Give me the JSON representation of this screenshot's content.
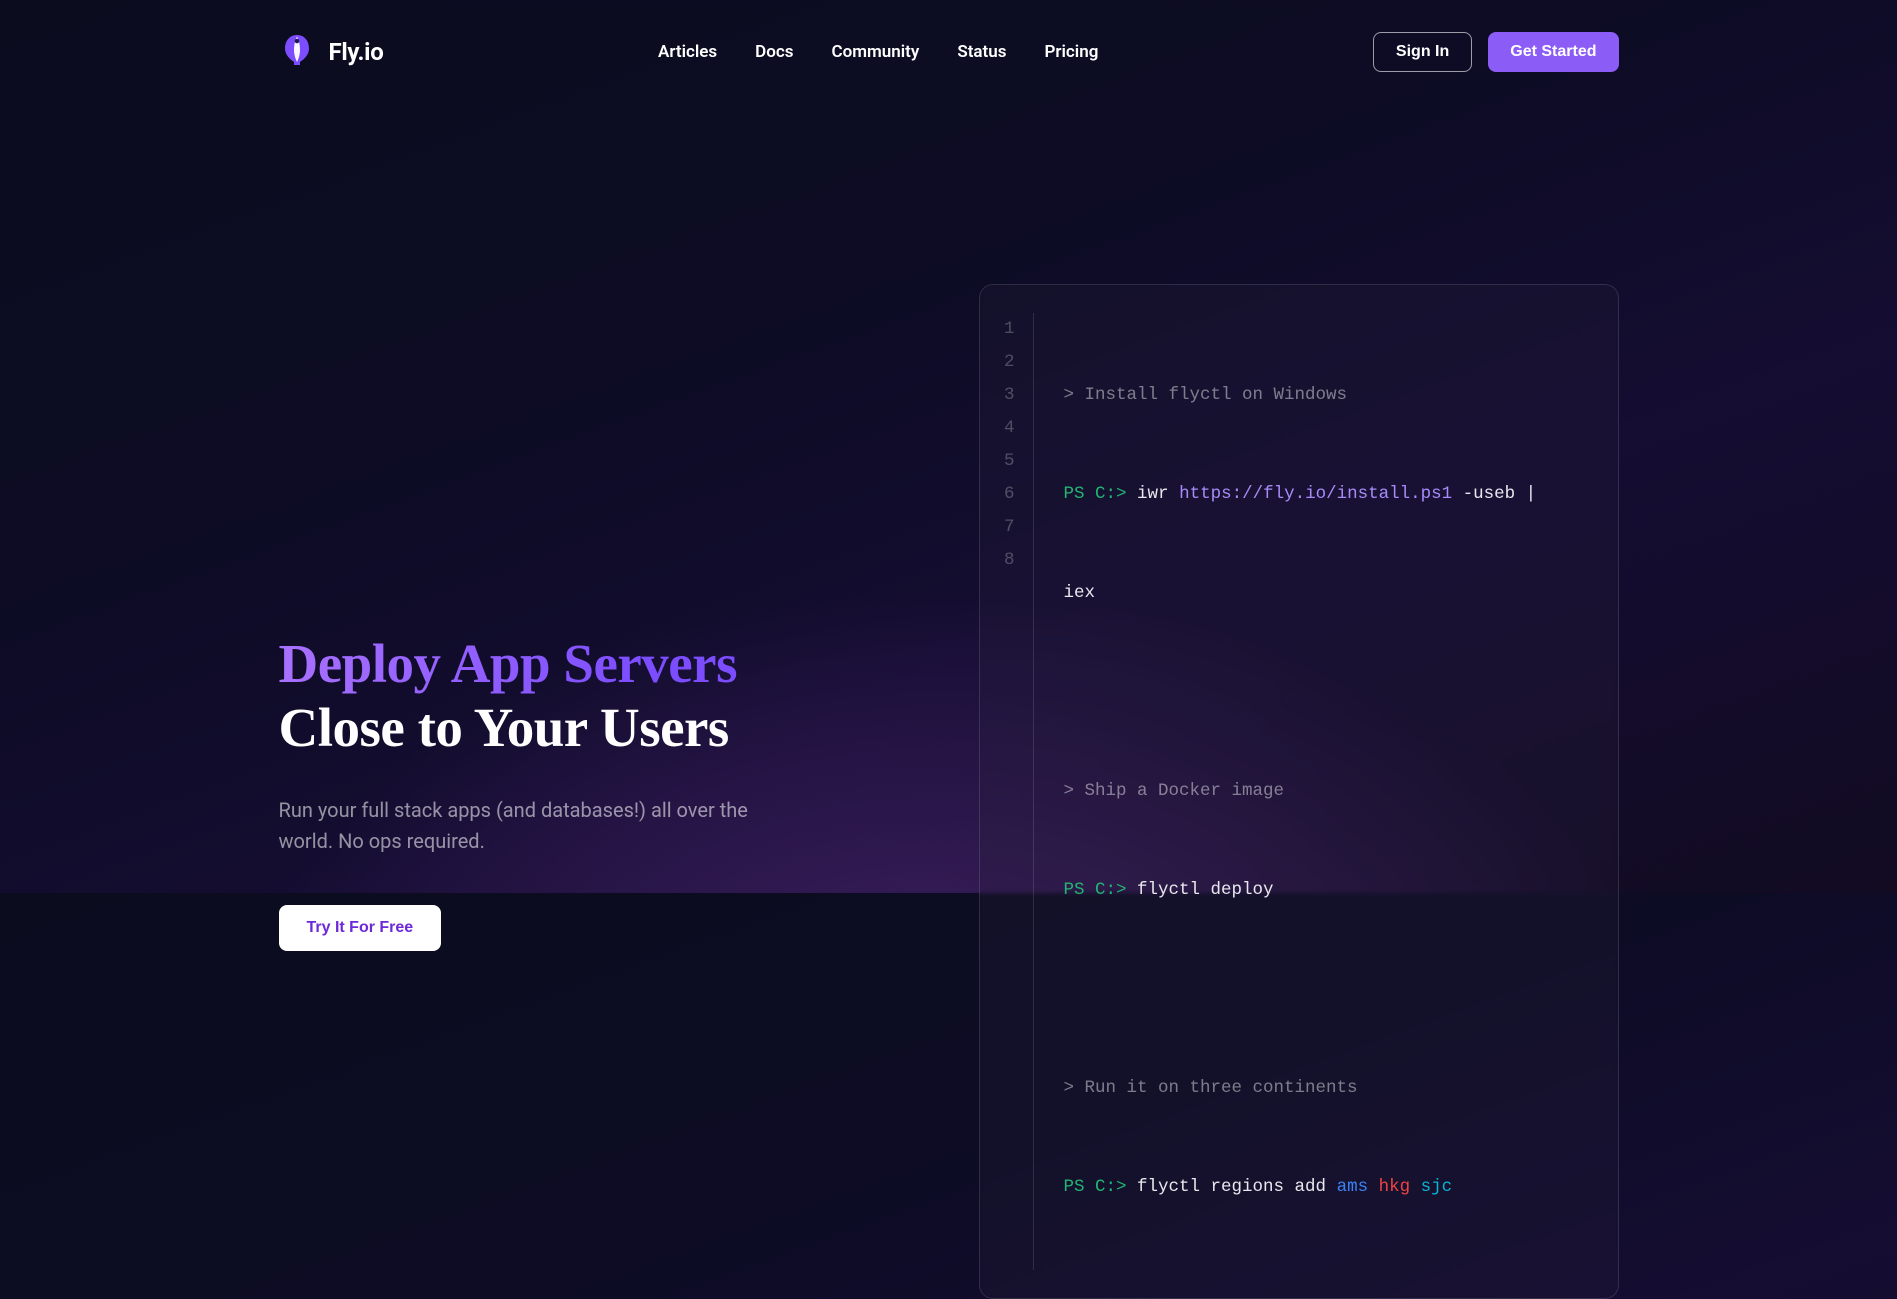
{
  "brand": {
    "name": "Fly.io"
  },
  "nav": {
    "links": [
      "Articles",
      "Docs",
      "Community",
      "Status",
      "Pricing"
    ],
    "signin": "Sign In",
    "getstarted": "Get Started"
  },
  "hero": {
    "title_line1": "Deploy App Servers",
    "title_line2": "Close to Your Users",
    "subtitle": "Run your full stack apps (and databases!) all over the world. No ops required.",
    "cta": "Try It For Free"
  },
  "code": {
    "line_numbers": [
      "1",
      "2",
      "3",
      "4",
      "5",
      "6",
      "7",
      "8"
    ],
    "tokens": {
      "comment1": "> Install flyctl on Windows",
      "ps": "PS C:>",
      "iwr": "iwr",
      "url": "https://fly.io/install.ps1",
      "opt1": "-useb |",
      "iex": "iex",
      "comment2": "> Ship a Docker image",
      "deploy": "flyctl deploy",
      "comment3": "> Run it on three continents",
      "regions": "flyctl regions add",
      "ams": "ams",
      "hkg": "hkg",
      "sjc": "sjc"
    }
  }
}
